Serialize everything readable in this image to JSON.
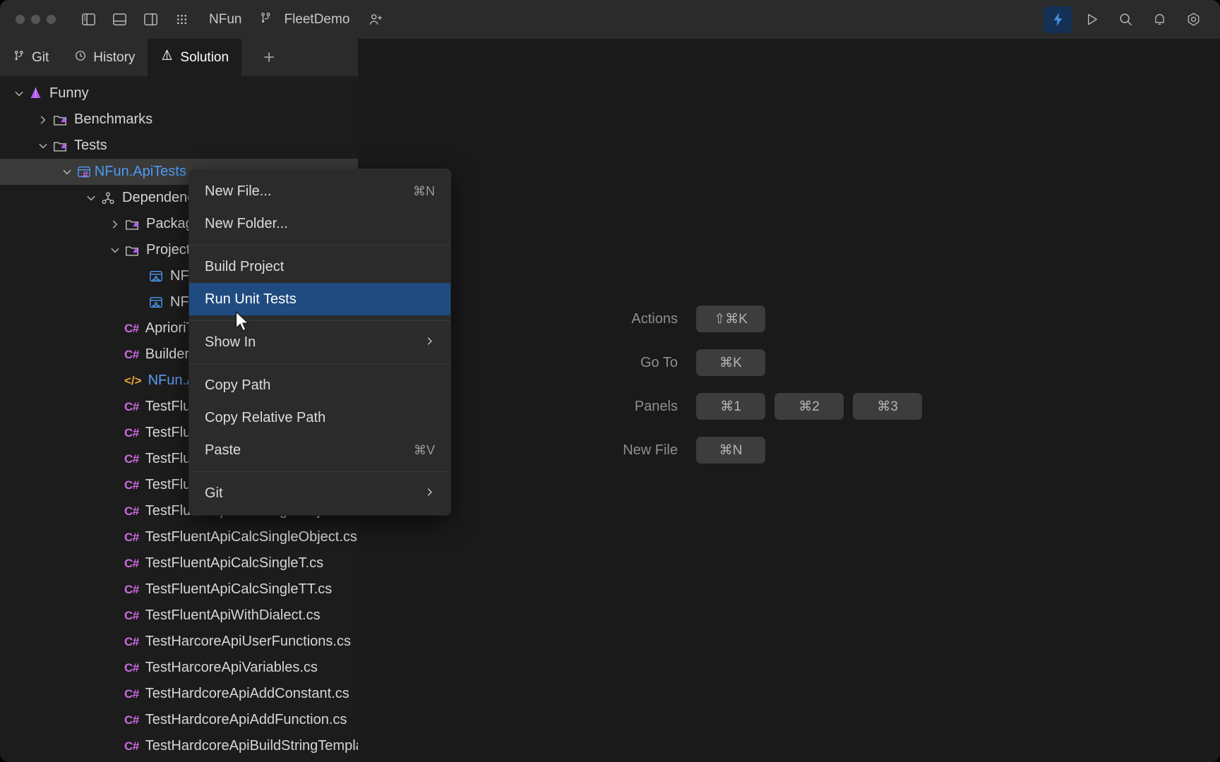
{
  "window": {
    "title_project": "NFun",
    "branch": "FleetDemo",
    "traffic_lights": [
      "close",
      "minimize",
      "zoom"
    ],
    "left_icons": [
      "left-panel-icon",
      "bottom-panel-icon",
      "right-panel-icon",
      "grid-apps-icon"
    ],
    "add_user_icon": "add-user-icon",
    "branch_icon": "branch-icon",
    "right_icons": [
      "lightning-icon",
      "run-icon",
      "search-icon",
      "notifications-icon",
      "settings-icon"
    ]
  },
  "tabs": [
    {
      "label": "Git",
      "icon": "branch-icon",
      "selected": false
    },
    {
      "label": "History",
      "icon": "clock-icon",
      "selected": false
    },
    {
      "label": "Solution",
      "icon": "solution-icon",
      "selected": true
    }
  ],
  "tab_add_label": "+",
  "tree": [
    {
      "label": "Funny",
      "indent": 0,
      "chevron": "down",
      "icon": "solution-icon",
      "kind": "solution",
      "selected": false
    },
    {
      "label": "Benchmarks",
      "indent": 1,
      "chevron": "right",
      "icon": "folder-project-icon",
      "kind": "folder",
      "selected": false
    },
    {
      "label": "Tests",
      "indent": 1,
      "chevron": "down",
      "icon": "folder-project-icon",
      "kind": "folder",
      "selected": false
    },
    {
      "label": "NFun.ApiTests",
      "indent": 2,
      "chevron": "down",
      "icon": "csharp-project-icon",
      "kind": "project",
      "selected": true
    },
    {
      "label": "Dependencies",
      "indent": 3,
      "chevron": "down",
      "icon": "dependencies-icon",
      "kind": "deps",
      "selected": false
    },
    {
      "label": "Packages",
      "indent": 4,
      "chevron": "right",
      "icon": "folder-package-icon",
      "kind": "folder",
      "selected": false
    },
    {
      "label": "Projects",
      "indent": 4,
      "chevron": "down",
      "icon": "folder-reference-icon",
      "kind": "folder",
      "selected": false
    },
    {
      "label": "NFun",
      "indent": 5,
      "chevron": "none",
      "icon": "project-ref-icon",
      "kind": "projref",
      "selected": false
    },
    {
      "label": "NFun.TestTools",
      "indent": 5,
      "chevron": "none",
      "icon": "project-ref-icon",
      "kind": "projref",
      "selected": false
    },
    {
      "label": "AprioriTypesTest.cs",
      "indent": 4,
      "chevron": "none",
      "icon": "cs-icon",
      "kind": "cs",
      "selected": false
    },
    {
      "label": "BuilderTest.cs",
      "indent": 4,
      "chevron": "none",
      "icon": "cs-icon",
      "kind": "cs",
      "selected": false
    },
    {
      "label": "NFun.ApiTests.csproj",
      "indent": 4,
      "chevron": "none",
      "icon": "xml-icon",
      "kind": "xml",
      "selected": false
    },
    {
      "label": "TestFluentApiCalcManyT.cs",
      "indent": 4,
      "chevron": "none",
      "icon": "cs-icon",
      "kind": "cs",
      "selected": false
    },
    {
      "label": "TestFluentApiCalcManyTT.cs",
      "indent": 4,
      "chevron": "none",
      "icon": "cs-icon",
      "kind": "cs",
      "selected": false
    },
    {
      "label": "TestFluentApiCalcObject.cs",
      "indent": 4,
      "chevron": "none",
      "icon": "cs-icon",
      "kind": "cs",
      "selected": false
    },
    {
      "label": "TestFluentApiCalcSingle.cs",
      "indent": 4,
      "chevron": "none",
      "icon": "cs-icon",
      "kind": "cs",
      "selected": false
    },
    {
      "label": "TestFluentApiCalcSingleObject.cs",
      "indent": 4,
      "chevron": "none",
      "icon": "cs-icon",
      "kind": "cs",
      "selected": false
    },
    {
      "label": "TestFluentApiCalcSingleObject.cs",
      "indent": 4,
      "chevron": "none",
      "icon": "cs-icon",
      "kind": "cs",
      "selected": false
    },
    {
      "label": "TestFluentApiCalcSingleT.cs",
      "indent": 4,
      "chevron": "none",
      "icon": "cs-icon",
      "kind": "cs",
      "selected": false
    },
    {
      "label": "TestFluentApiCalcSingleTT.cs",
      "indent": 4,
      "chevron": "none",
      "icon": "cs-icon",
      "kind": "cs",
      "selected": false
    },
    {
      "label": "TestFluentApiWithDialect.cs",
      "indent": 4,
      "chevron": "none",
      "icon": "cs-icon",
      "kind": "cs",
      "selected": false
    },
    {
      "label": "TestHarcoreApiUserFunctions.cs",
      "indent": 4,
      "chevron": "none",
      "icon": "cs-icon",
      "kind": "cs",
      "selected": false
    },
    {
      "label": "TestHarcoreApiVariables.cs",
      "indent": 4,
      "chevron": "none",
      "icon": "cs-icon",
      "kind": "cs",
      "selected": false
    },
    {
      "label": "TestHardcoreApiAddConstant.cs",
      "indent": 4,
      "chevron": "none",
      "icon": "cs-icon",
      "kind": "cs",
      "selected": false
    },
    {
      "label": "TestHardcoreApiAddFunction.cs",
      "indent": 4,
      "chevron": "none",
      "icon": "cs-icon",
      "kind": "cs",
      "selected": false
    },
    {
      "label": "TestHardcoreApiBuildStringTemplate.cs",
      "indent": 4,
      "chevron": "none",
      "icon": "cs-icon",
      "kind": "cs",
      "selected": false
    }
  ],
  "context_menu": {
    "items": [
      {
        "label": "New File...",
        "shortcut": "⌘N",
        "type": "item",
        "highlighted": false
      },
      {
        "label": "New Folder...",
        "shortcut": "",
        "type": "item",
        "highlighted": false
      },
      {
        "type": "separator"
      },
      {
        "label": "Build Project",
        "shortcut": "",
        "type": "item",
        "highlighted": false
      },
      {
        "label": "Run Unit Tests",
        "shortcut": "",
        "type": "item",
        "highlighted": true
      },
      {
        "type": "separator"
      },
      {
        "label": "Show In",
        "shortcut": "",
        "type": "submenu",
        "highlighted": false
      },
      {
        "type": "separator"
      },
      {
        "label": "Copy Path",
        "shortcut": "",
        "type": "item",
        "highlighted": false
      },
      {
        "label": "Copy Relative Path",
        "shortcut": "",
        "type": "item",
        "highlighted": false
      },
      {
        "label": "Paste",
        "shortcut": "⌘V",
        "type": "item",
        "highlighted": false
      },
      {
        "type": "separator"
      },
      {
        "label": "Git",
        "shortcut": "",
        "type": "submenu",
        "highlighted": false
      }
    ]
  },
  "hints": [
    {
      "label": "Actions",
      "keys": [
        "⇧⌘K"
      ]
    },
    {
      "label": "Go To",
      "keys": [
        "⌘K"
      ]
    },
    {
      "label": "Panels",
      "keys": [
        "⌘1",
        "⌘2",
        "⌘3"
      ]
    },
    {
      "label": "New File",
      "keys": [
        "⌘N"
      ]
    }
  ],
  "colors": {
    "accent_blue": "#1f4b80",
    "link_blue": "#4c9bf5",
    "cs_purple": "#cf6ae3",
    "xml_orange": "#e8a33d",
    "solution_purple": "#b05cf0",
    "window_bg": "#2b2b2b",
    "sidebar_bg": "#1c1c1c",
    "pane_bg": "#1a1a1a"
  }
}
